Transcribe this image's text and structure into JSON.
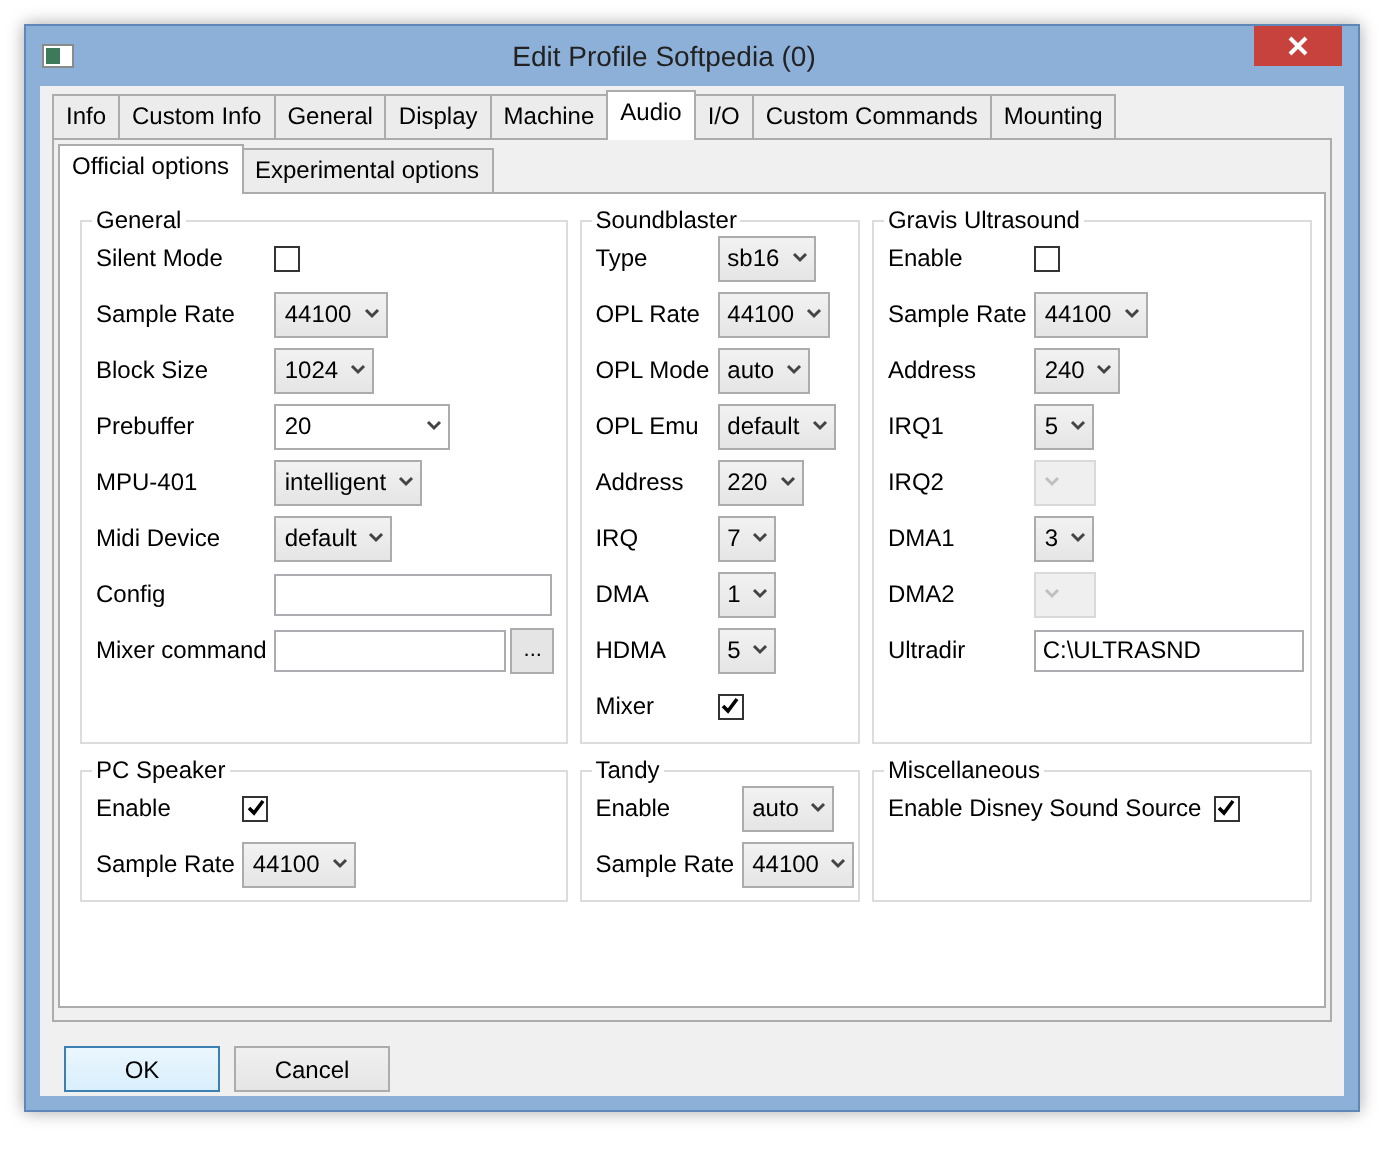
{
  "window": {
    "title": "Edit Profile Softpedia (0)"
  },
  "tabs": [
    {
      "label": "Info",
      "selected": false
    },
    {
      "label": "Custom Info",
      "selected": false
    },
    {
      "label": "General",
      "selected": false
    },
    {
      "label": "Display",
      "selected": false
    },
    {
      "label": "Machine",
      "selected": false
    },
    {
      "label": "Audio",
      "selected": true
    },
    {
      "label": "I/O",
      "selected": false
    },
    {
      "label": "Custom Commands",
      "selected": false
    },
    {
      "label": "Mounting",
      "selected": false
    }
  ],
  "subtabs": [
    {
      "label": "Official options",
      "selected": true
    },
    {
      "label": "Experimental options",
      "selected": false
    }
  ],
  "top_groups": [
    {
      "title": "General",
      "fields": [
        {
          "kind": "checkbox",
          "label": "Silent Mode",
          "checked": false
        },
        {
          "kind": "combo",
          "label": "Sample Rate",
          "value": "44100",
          "disabled": false
        },
        {
          "kind": "combo",
          "label": "Block Size",
          "value": "1024",
          "disabled": false
        },
        {
          "kind": "editable_combo",
          "label": "Prebuffer",
          "value": "20"
        },
        {
          "kind": "combo",
          "label": "MPU-401",
          "value": "intelligent",
          "disabled": false
        },
        {
          "kind": "combo",
          "label": "Midi Device",
          "value": "default",
          "disabled": false
        },
        {
          "kind": "text",
          "label": "Config"
        },
        {
          "kind": "text_browse",
          "label": "Mixer command",
          "button_label": "..."
        }
      ]
    },
    {
      "title": "Soundblaster",
      "fields": [
        {
          "kind": "combo",
          "label": "Type",
          "value": "sb16",
          "disabled": false
        },
        {
          "kind": "combo",
          "label": "OPL Rate",
          "value": "44100",
          "disabled": false
        },
        {
          "kind": "combo",
          "label": "OPL Mode",
          "value": "auto",
          "disabled": false
        },
        {
          "kind": "combo",
          "label": "OPL Emu",
          "value": "default",
          "disabled": false
        },
        {
          "kind": "combo",
          "label": "Address",
          "value": "220",
          "disabled": false
        },
        {
          "kind": "combo",
          "label": "IRQ",
          "value": "7",
          "disabled": false
        },
        {
          "kind": "combo",
          "label": "DMA",
          "value": "1",
          "disabled": false
        },
        {
          "kind": "combo",
          "label": "HDMA",
          "value": "5",
          "disabled": false
        },
        {
          "kind": "checkbox",
          "label": "Mixer",
          "checked": true
        }
      ]
    },
    {
      "title": "Gravis Ultrasound",
      "fields": [
        {
          "kind": "checkbox",
          "label": "Enable",
          "checked": false
        },
        {
          "kind": "combo",
          "label": "Sample Rate",
          "value": "44100",
          "disabled": false
        },
        {
          "kind": "combo",
          "label": "Address",
          "value": "240",
          "disabled": false
        },
        {
          "kind": "combo",
          "label": "IRQ1",
          "value": "5",
          "disabled": false
        },
        {
          "kind": "combo",
          "label": "IRQ2",
          "disabled": true
        },
        {
          "kind": "combo",
          "label": "DMA1",
          "value": "3",
          "disabled": false
        },
        {
          "kind": "combo",
          "label": "DMA2",
          "disabled": true
        },
        {
          "kind": "text",
          "label": "Ultradir",
          "value": "C:\\ULTRASND"
        }
      ]
    }
  ],
  "bottom_groups": [
    {
      "title": "PC Speaker",
      "fields": [
        {
          "kind": "checkbox",
          "label": "Enable",
          "checked": true
        },
        {
          "kind": "combo",
          "label": "Sample Rate",
          "value": "44100",
          "disabled": false
        }
      ]
    },
    {
      "title": "Tandy",
      "fields": [
        {
          "kind": "combo",
          "label": "Enable",
          "value": "auto",
          "disabled": false
        },
        {
          "kind": "combo",
          "label": "Sample Rate",
          "value": "44100",
          "disabled": false
        }
      ]
    },
    {
      "title": "Miscellaneous",
      "fields": [
        {
          "kind": "inline_checkbox",
          "label": "Enable Disney Sound Source",
          "checked": true
        }
      ]
    }
  ],
  "buttons": [
    {
      "label": "OK",
      "default": true
    },
    {
      "label": "Cancel",
      "default": false
    }
  ]
}
